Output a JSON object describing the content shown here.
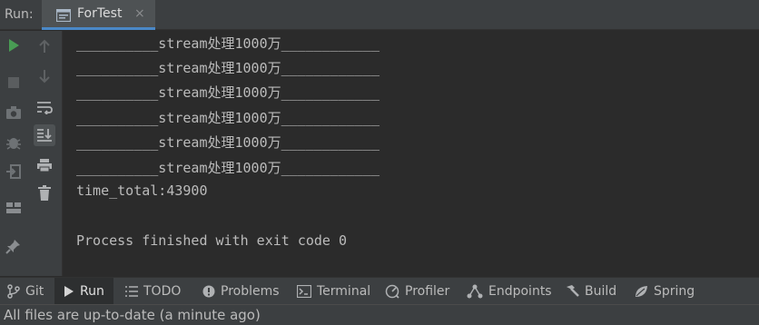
{
  "header": {
    "run_label": "Run:",
    "tab_title": "ForTest",
    "tab_close": "×"
  },
  "left_toolbar": {
    "buttons": [
      "run-icon",
      "stop-icon",
      "camera-icon",
      "debug-bug-icon",
      "exit-icon",
      "layout-icon",
      "pin-icon"
    ]
  },
  "secondary_toolbar": {
    "buttons": [
      "arrow-up-icon",
      "arrow-down-icon",
      "soft-wrap-icon",
      "scroll-to-end-icon",
      "print-icon",
      "trash-icon"
    ]
  },
  "console": {
    "lines": [
      "__________stream处理1000万____________",
      "__________stream处理1000万____________",
      "__________stream处理1000万____________",
      "__________stream处理1000万____________",
      "__________stream处理1000万____________",
      "__________stream处理1000万____________",
      "time_total:43900",
      "",
      "Process finished with exit code 0"
    ]
  },
  "tool_tabs": [
    {
      "label": "Git",
      "icon": "git-branch-icon"
    },
    {
      "label": "Run",
      "icon": "run-play-icon",
      "active": true
    },
    {
      "label": "TODO",
      "icon": "list-icon"
    },
    {
      "label": "Problems",
      "icon": "problems-icon"
    },
    {
      "label": "Terminal",
      "icon": "terminal-icon"
    },
    {
      "label": "Profiler",
      "icon": "profiler-icon"
    },
    {
      "label": "Endpoints",
      "icon": "endpoints-icon"
    },
    {
      "label": "Build",
      "icon": "hammer-icon"
    },
    {
      "label": "Spring",
      "icon": "spring-leaf-icon"
    }
  ],
  "status_bar": {
    "text": "All files are up-to-date (a minute ago)"
  },
  "colors": {
    "accent": "#4a88c7",
    "run_green": "#499c54",
    "panel": "#3c3f41",
    "console_bg": "#2b2b2b"
  }
}
